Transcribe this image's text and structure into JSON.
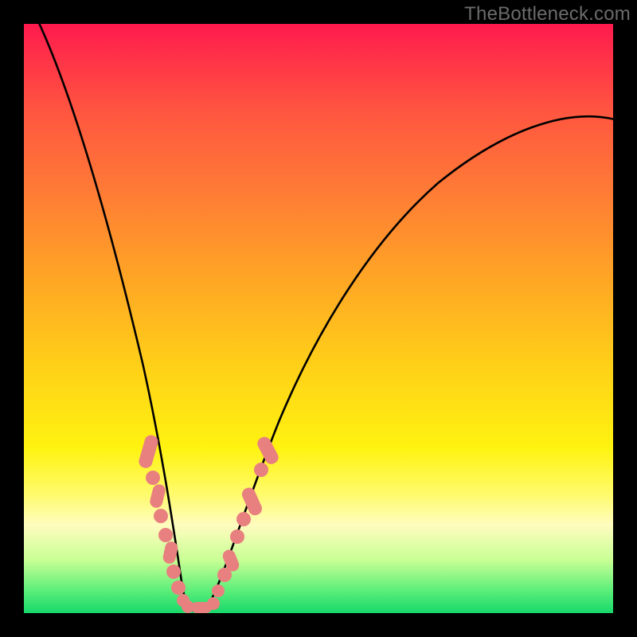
{
  "watermark": "TheBottleneck.com",
  "chart_data": {
    "type": "line",
    "title": "",
    "xlabel": "",
    "ylabel": "",
    "xlim": [
      0,
      100
    ],
    "ylim": [
      0,
      100
    ],
    "background_gradient": {
      "top": "#ff1a4d",
      "mid_upper": "#ff7a36",
      "mid": "#ffd018",
      "mid_lower": "#fffb6e",
      "bottom": "#16d86a"
    },
    "series": [
      {
        "name": "bottleneck-curve",
        "color": "#000000",
        "x": [
          0,
          4,
          8,
          12,
          15,
          18,
          20,
          22,
          24,
          25,
          26,
          27,
          28,
          29,
          30,
          31,
          33,
          35,
          38,
          42,
          46,
          52,
          58,
          66,
          74,
          82,
          90,
          100
        ],
        "y": [
          100,
          86,
          72,
          58,
          46,
          36,
          28,
          20,
          12,
          6,
          2,
          0,
          0,
          0,
          2,
          5,
          10,
          18,
          28,
          38,
          48,
          58,
          66,
          74,
          80,
          84,
          87,
          82
        ]
      }
    ],
    "markers": {
      "color": "#e98080",
      "left_branch": [
        {
          "x": 20.5,
          "y": 27
        },
        {
          "x": 21.3,
          "y": 23
        },
        {
          "x": 22.0,
          "y": 19
        },
        {
          "x": 22.9,
          "y": 14.5
        },
        {
          "x": 23.4,
          "y": 12
        },
        {
          "x": 24.1,
          "y": 9
        },
        {
          "x": 24.8,
          "y": 6.5
        },
        {
          "x": 25.5,
          "y": 4
        },
        {
          "x": 26.1,
          "y": 2.3
        }
      ],
      "right_branch": [
        {
          "x": 31.2,
          "y": 5
        },
        {
          "x": 32.0,
          "y": 8
        },
        {
          "x": 32.7,
          "y": 10.5
        },
        {
          "x": 33.4,
          "y": 13
        },
        {
          "x": 34.6,
          "y": 17
        },
        {
          "x": 35.6,
          "y": 20
        },
        {
          "x": 36.8,
          "y": 24
        },
        {
          "x": 38.1,
          "y": 28
        }
      ],
      "valley": [
        {
          "x": 26.8,
          "y": 1
        },
        {
          "x": 27.6,
          "y": 0.5
        },
        {
          "x": 28.6,
          "y": 0.5
        },
        {
          "x": 29.5,
          "y": 1
        },
        {
          "x": 30.3,
          "y": 2
        }
      ]
    }
  }
}
